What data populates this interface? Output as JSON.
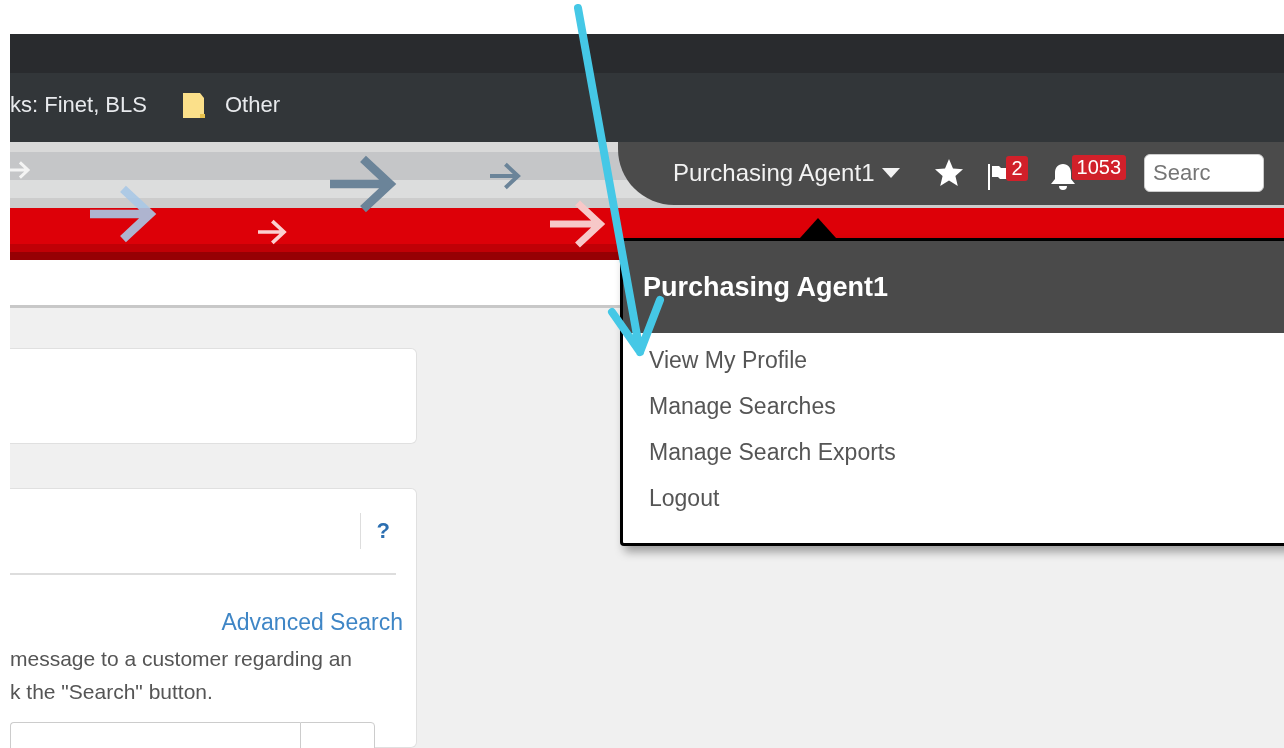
{
  "bookmarks": [
    {
      "kind": "link",
      "label": "ks: Finet, BLS"
    },
    {
      "kind": "folder",
      "label": "Other"
    }
  ],
  "header": {
    "user_menu": {
      "label": "Purchasing Agent1",
      "expanded": true
    },
    "flags": {
      "count": "2"
    },
    "notifications": {
      "count": "1053"
    },
    "search": {
      "placeholder": "Searc"
    }
  },
  "user_dropdown": {
    "title": "Purchasing Agent1",
    "items": [
      {
        "label": "View My Profile"
      },
      {
        "label": "Manage Searches"
      },
      {
        "label": "Manage Search Exports"
      },
      {
        "label": "Logout"
      }
    ]
  },
  "search_panel": {
    "help": "?",
    "advanced_link": "Advanced Search",
    "description_lines": [
      "message to a customer regarding an",
      "k the \"Search\" button."
    ]
  }
}
